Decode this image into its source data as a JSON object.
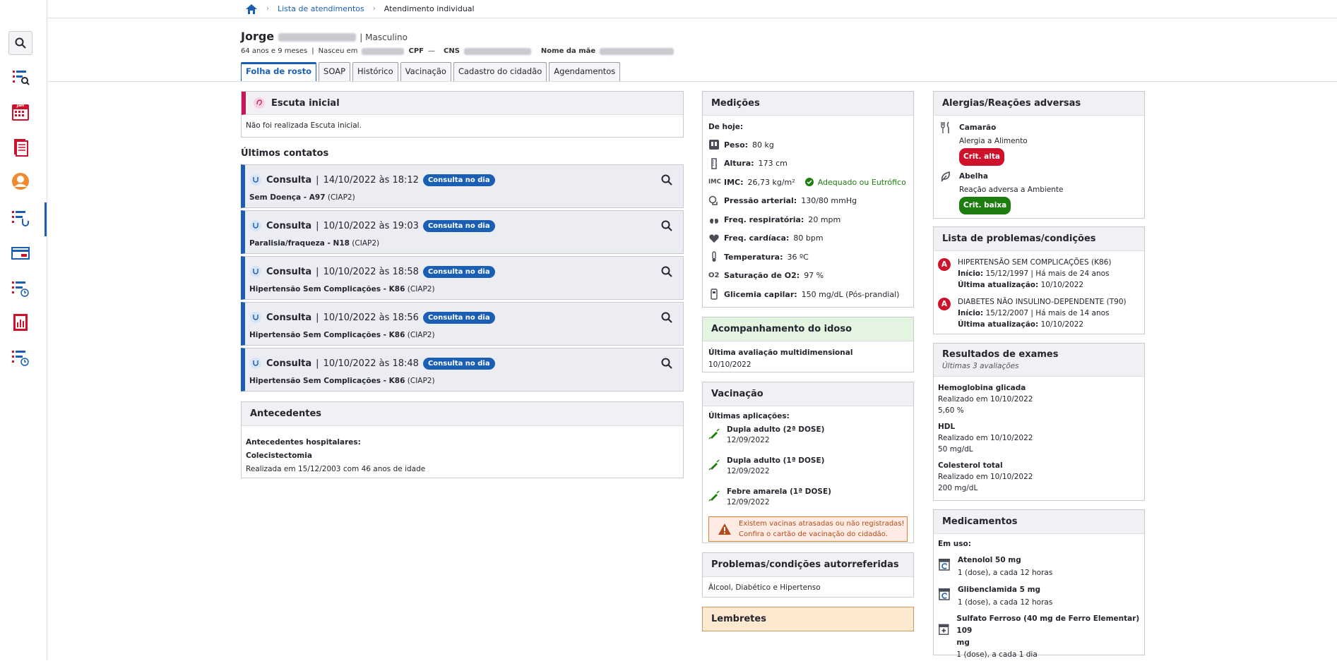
{
  "breadcrumb": {
    "home": "home-icon",
    "list": "Lista de atendimentos",
    "current": "Atendimento individual"
  },
  "patient": {
    "first_name": "Jorge",
    "sex": "Masculino",
    "age": "64 anos e 9 meses",
    "born_label": "Nasceu em",
    "cpf_label": "CPF",
    "cpf_value": "—",
    "cns_label": "CNS",
    "mother_label": "Nome da mãe"
  },
  "tabs": [
    "Folha de rosto",
    "SOAP",
    "Histórico",
    "Vacinação",
    "Cadastro do cidadão",
    "Agendamentos"
  ],
  "escuta": {
    "title": "Escuta inicial",
    "text": "Não foi realizada Escuta inicial."
  },
  "contacts": {
    "title": "Últimos contatos",
    "items": [
      {
        "type": "Consulta",
        "date": "14/10/2022 às 18:12",
        "badge": "Consulta no dia",
        "diag": "Sem Doença - A97",
        "code": "(CIAP2)"
      },
      {
        "type": "Consulta",
        "date": "10/10/2022 às 19:03",
        "badge": "Consulta no dia",
        "diag": "Paralisia/fraqueza - N18",
        "code": "(CIAP2)"
      },
      {
        "type": "Consulta",
        "date": "10/10/2022 às 18:58",
        "badge": "Consulta no dia",
        "diag": "Hipertensão Sem Complicações - K86",
        "code": "(CIAP2)"
      },
      {
        "type": "Consulta",
        "date": "10/10/2022 às 18:56",
        "badge": "Consulta no dia",
        "diag": "Hipertensão Sem Complicações - K86",
        "code": "(CIAP2)"
      },
      {
        "type": "Consulta",
        "date": "10/10/2022 às 18:48",
        "badge": "Consulta no dia",
        "diag": "Hipertensão Sem Complicações - K86",
        "code": "(CIAP2)"
      }
    ]
  },
  "antecedentes": {
    "title": "Antecedentes",
    "section": "Antecedentes hospitalares:",
    "item": "Colecistectomia",
    "detail": "Realizada em 15/12/2003 com 46 anos de idade"
  },
  "medicoes": {
    "title": "Medições",
    "today": "De hoje:",
    "items": [
      {
        "label": "Peso:",
        "value": "80 kg"
      },
      {
        "label": "Altura:",
        "value": "173 cm"
      },
      {
        "label": "IMC:",
        "value": "26,73 kg/m²",
        "status": "Adequado ou Eutrófico"
      },
      {
        "label": "Pressão arterial:",
        "value": "130/80 mmHg"
      },
      {
        "label": "Freq. respiratória:",
        "value": "20 mpm"
      },
      {
        "label": "Freq. cardíaca:",
        "value": "80 bpm"
      },
      {
        "label": "Temperatura:",
        "value": "36 ºC"
      },
      {
        "label": "Saturação de O2:",
        "value": "97 %"
      },
      {
        "label": "Glicemia capilar:",
        "value": "150 mg/dL (Pós-prandial)"
      }
    ],
    "imc_icon": "IMC",
    "o2_icon": "O2"
  },
  "idoso": {
    "title": "Acompanhamento do idoso",
    "label": "Última avaliação multidimensional",
    "date": "10/10/2022"
  },
  "vacinacao": {
    "title": "Vacinação",
    "subtitle": "Últimas aplicações:",
    "items": [
      {
        "name": "Dupla adulto (2ª DOSE)",
        "date": "12/09/2022"
      },
      {
        "name": "Dupla adulto (1ª DOSE)",
        "date": "12/09/2022"
      },
      {
        "name": "Febre amarela (1ª DOSE)",
        "date": "12/09/2022"
      }
    ],
    "alert1": "Existem vacinas atrasadas ou não registradas!",
    "alert2": "Confira o cartão de vacinação do cidadão."
  },
  "autorref": {
    "title": "Problemas/condições autorreferidas",
    "text": "Álcool, Diabético e Hipertenso"
  },
  "lembretes": {
    "title": "Lembretes"
  },
  "alergias": {
    "title": "Alergias/Reações adversas",
    "items": [
      {
        "name": "Camarão",
        "type": "Alergia a Alimento",
        "crit": "Crit. alta",
        "color": "#d0112b"
      },
      {
        "name": "Abelha",
        "type": "Reação adversa a Ambiente",
        "crit": "Crit. baixa",
        "color": "#1d7d0e"
      }
    ]
  },
  "problemas": {
    "title": "Lista de problemas/condições",
    "items": [
      {
        "name": "HIPERTENSÃO SEM COMPLICAÇÕES (K86)",
        "inicio_label": "Início:",
        "inicio": "15/12/1997 | Há mais de 24 anos",
        "upd_label": "Última atualização:",
        "upd": "10/10/2022"
      },
      {
        "name": "DIABETES NÃO INSULINO-DEPENDENTE (T90)",
        "inicio_label": "Início:",
        "inicio": "15/12/2007 | Há mais de 14 anos",
        "upd_label": "Última atualização:",
        "upd": "10/10/2022"
      }
    ],
    "badge": "A"
  },
  "exames": {
    "title": "Resultados de exames",
    "subtitle": "Últimas 3 avaliações",
    "items": [
      {
        "name": "Hemoglobina glicada",
        "date": "Realizado em 10/10/2022",
        "value": "5,60 %"
      },
      {
        "name": "HDL",
        "date": "Realizado em 10/10/2022",
        "value": "50 mg/dL"
      },
      {
        "name": "Colesterol total",
        "date": "Realizado em 10/10/2022",
        "value": "200 mg/dL"
      }
    ]
  },
  "medicamentos": {
    "title": "Medicamentos",
    "subtitle": "Em uso:",
    "items": [
      {
        "name": "Atenolol 50 mg",
        "dose": "1 (dose), a cada 12 horas"
      },
      {
        "name": "Glibenclamida 5 mg",
        "dose": "1 (dose), a cada 12 horas"
      },
      {
        "name": "Sulfato Ferroso (40 mg de Ferro Elementar) 109",
        "name2": "mg",
        "dose": "1 (dose), a cada 1 dia"
      }
    ]
  },
  "calendar_label": "Jan",
  "colors": {
    "primary": "#1b5fb4",
    "danger": "#d0112b",
    "success": "#1d7d0e"
  }
}
